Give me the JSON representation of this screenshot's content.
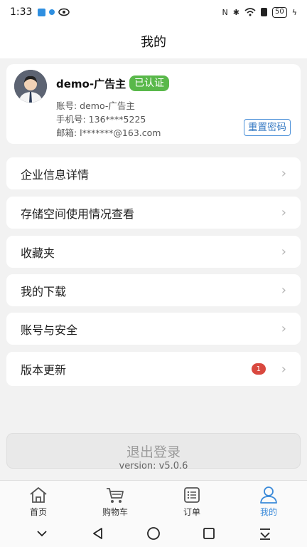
{
  "status": {
    "time": "1:33",
    "battery": "50"
  },
  "header": {
    "title": "我的"
  },
  "profile": {
    "name": "demo-广告主",
    "badge": "已认证",
    "account": "账号: demo-广告主",
    "phone": "手机号: 136****5225",
    "email": "邮箱: l*******@163.com",
    "reset_label": "重置密码"
  },
  "menu": [
    {
      "label": "企业信息详情"
    },
    {
      "label": "存储空间使用情况查看"
    },
    {
      "label": "收藏夹"
    },
    {
      "label": "我的下载"
    },
    {
      "label": "账号与安全"
    },
    {
      "label": "版本更新",
      "badge": "1"
    }
  ],
  "logout": {
    "label": "退出登录"
  },
  "version": "version:  v5.0.6",
  "tabs": [
    {
      "label": "首页",
      "icon": "home-icon"
    },
    {
      "label": "购物车",
      "icon": "cart-icon"
    },
    {
      "label": "订单",
      "icon": "order-icon"
    },
    {
      "label": "我的",
      "icon": "person-icon",
      "active": true
    }
  ],
  "colors": {
    "accent": "#3b8ad9",
    "verified": "#59b84a",
    "badge": "#d9483f"
  }
}
